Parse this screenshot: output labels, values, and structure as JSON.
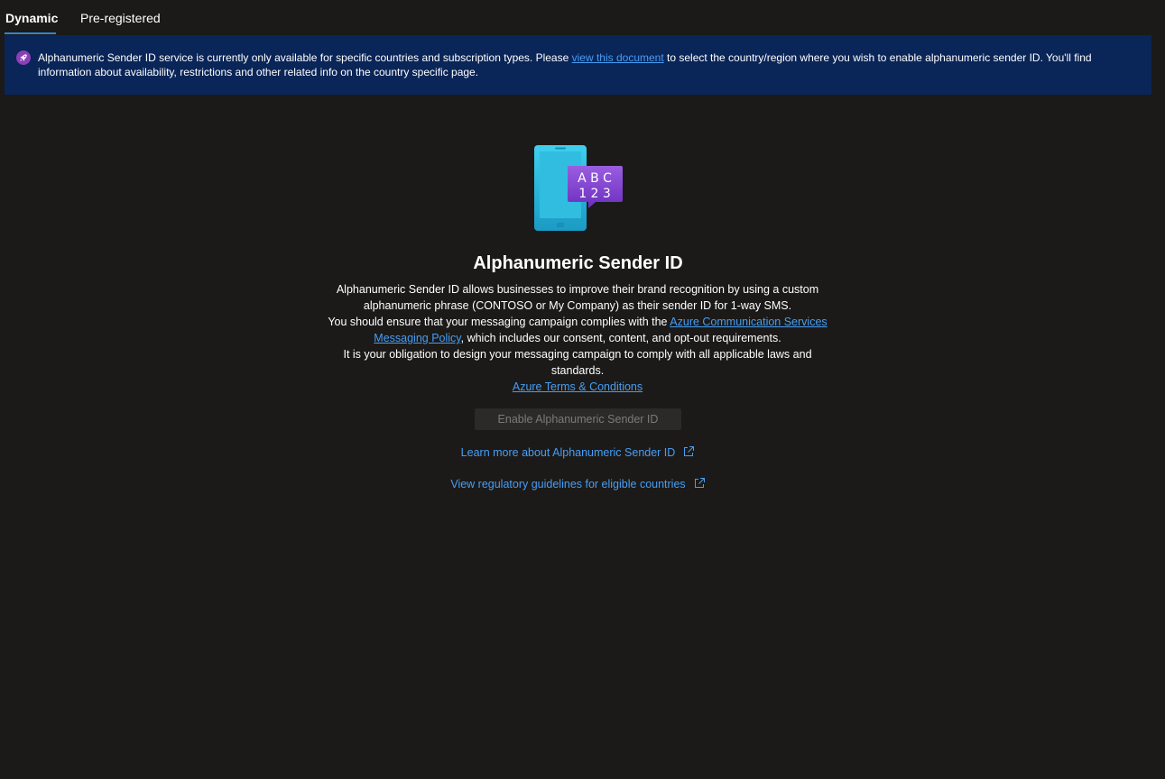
{
  "tabs": [
    {
      "label": "Dynamic",
      "active": true
    },
    {
      "label": "Pre-registered",
      "active": false
    }
  ],
  "banner": {
    "icon": "rocket-icon",
    "text_before": "Alphanumeric Sender ID service is currently only available for specific countries and subscription types. Please ",
    "link_text": "view this document",
    "text_after": " to select the country/region where you wish to enable alphanumeric sender ID. You'll find information about availability, restrictions and other related info on the country specific page."
  },
  "hero": {
    "icon": "phone-abc-123-icon",
    "icon_letters_top": "A B C",
    "icon_letters_bottom": "1 2 3",
    "title": "Alphanumeric Sender ID",
    "para1": "Alphanumeric Sender ID allows businesses to improve their brand recognition by using a custom alphanumeric phrase (CONTOSO or My Company) as their sender ID for 1-way SMS.",
    "para2_before": "You should ensure that your messaging campaign complies with the ",
    "para2_link": "Azure Communication Services Messaging Policy",
    "para2_after": ", which includes our consent, content, and opt-out requirements.",
    "para3": "It is your obligation to design your messaging campaign to comply with all applicable laws and standards.",
    "terms_link": "Azure Terms & Conditions"
  },
  "actions": {
    "enable_label": "Enable Alphanumeric Sender ID",
    "learn_more_label": "Learn more about Alphanumeric Sender ID",
    "regulatory_label": "View regulatory guidelines for eligible countries"
  },
  "colors": {
    "background": "#1b1a19",
    "banner": "#0a2558",
    "link": "#479ef5",
    "tab_underline": "#2b88d8"
  }
}
